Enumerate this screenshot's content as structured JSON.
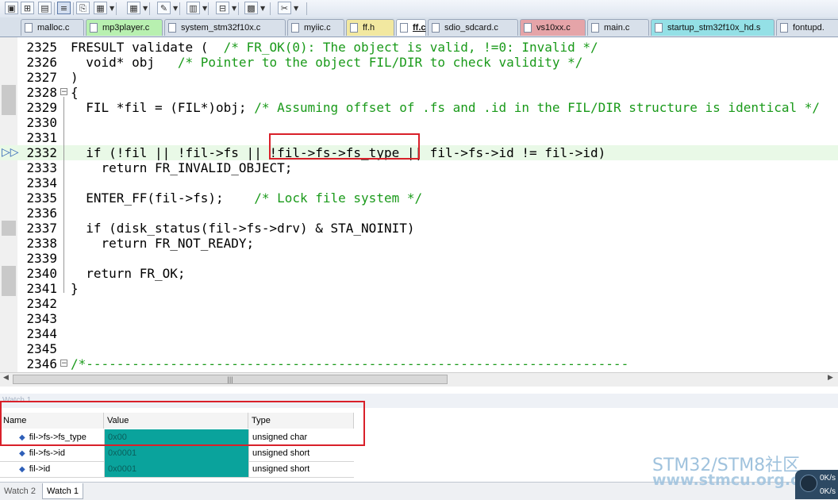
{
  "toolbar": {
    "icons": [
      "editor-icon",
      "find-icon",
      "debug-icon",
      "window-icon",
      "copy-icon",
      "layout-icon",
      "table-icon",
      "tools-icon",
      "chart-icon",
      "view-icon",
      "grid-icon",
      "settings-icon"
    ]
  },
  "tabs": [
    {
      "label": "malloc.c",
      "color": "#d8e0ea"
    },
    {
      "label": "mp3player.c",
      "color": "#b8f0b0"
    },
    {
      "label": "system_stm32f10x.c",
      "color": "#d8e0ea"
    },
    {
      "label": "myiic.c",
      "color": "#d8e0ea"
    },
    {
      "label": "ff.h",
      "color": "#f2e8a0"
    },
    {
      "label": "ff.c",
      "color": "#ffffff"
    },
    {
      "label": "sdio_sdcard.c",
      "color": "#d8e0ea"
    },
    {
      "label": "vs10xx.c",
      "color": "#e5a4a8"
    },
    {
      "label": "main.c",
      "color": "#d8e0ea"
    },
    {
      "label": "startup_stm32f10x_hd.s",
      "color": "#94e0e6"
    },
    {
      "label": "fontupd.",
      "color": "#d8e0ea"
    }
  ],
  "code": {
    "lines": [
      {
        "num": "2325",
        "code": "FRESULT validate (",
        "comment": "  /* FR_OK(0): The object is valid, !=0: Invalid */"
      },
      {
        "num": "2326",
        "code": "  void* obj",
        "comment": "   /* Pointer to the object FIL/DIR to check validity */"
      },
      {
        "num": "2327",
        "code": ")",
        "comment": ""
      },
      {
        "num": "2328",
        "code": "{",
        "comment": ""
      },
      {
        "num": "2329",
        "code": "  FIL *fil = (FIL*)obj;",
        "comment": " /* Assuming offset of .fs and .id in the FIL/DIR structure is identical */"
      },
      {
        "num": "2330",
        "code": "",
        "comment": ""
      },
      {
        "num": "2331",
        "code": "",
        "comment": ""
      },
      {
        "num": "2332",
        "code": "  if (!fil || !fil->fs || !fil->fs->fs_type || fil->fs->id != fil->id)",
        "comment": ""
      },
      {
        "num": "2333",
        "code": "    return FR_INVALID_OBJECT;",
        "comment": ""
      },
      {
        "num": "2334",
        "code": "",
        "comment": ""
      },
      {
        "num": "2335",
        "code": "  ENTER_FF(fil->fs);",
        "comment": "    /* Lock file system */"
      },
      {
        "num": "2336",
        "code": "",
        "comment": ""
      },
      {
        "num": "2337",
        "code": "  if (disk_status(fil->fs->drv) & STA_NOINIT)",
        "comment": ""
      },
      {
        "num": "2338",
        "code": "    return FR_NOT_READY;",
        "comment": ""
      },
      {
        "num": "2339",
        "code": "",
        "comment": ""
      },
      {
        "num": "2340",
        "code": "  return FR_OK;",
        "comment": ""
      },
      {
        "num": "2341",
        "code": "}",
        "comment": ""
      },
      {
        "num": "2342",
        "code": "",
        "comment": ""
      },
      {
        "num": "2343",
        "code": "",
        "comment": ""
      },
      {
        "num": "2344",
        "code": "",
        "comment": ""
      },
      {
        "num": "2345",
        "code": "",
        "comment": ""
      },
      {
        "num": "2346",
        "code": "",
        "comment": "/*-----------------------------------------------------------------------"
      }
    ]
  },
  "watch": {
    "panel_title": "Watch 1",
    "columns": {
      "name": "Name",
      "value": "Value",
      "type": "Type"
    },
    "rows": [
      {
        "name": "fil->fs->fs_type",
        "value": "0x00",
        "type": "unsigned char"
      },
      {
        "name": "fil->fs->id",
        "value": "0x0001",
        "type": "unsigned short"
      },
      {
        "name": "fil->id",
        "value": "0x0001",
        "type": "unsigned short"
      }
    ],
    "bottom_tabs": [
      "Watch 2",
      "Watch 1"
    ]
  },
  "watermark": {
    "line1": "STM32/STM8社区",
    "line2": "www.stmcu.org.cn"
  },
  "network": {
    "up": "0K/s",
    "down": "0K/s"
  }
}
